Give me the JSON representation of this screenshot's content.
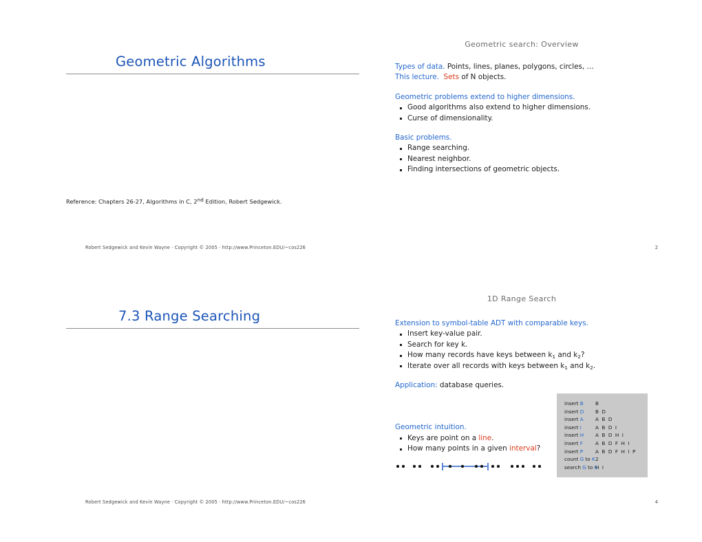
{
  "document": {
    "type": "lecture-slides-handout",
    "colors": {
      "heading_blue": "#2266cc",
      "title_blue": "#1b54b8",
      "accent_red": "#d93a1a",
      "table_background": "#c9c9c9",
      "rule_gray": "#8b8b8b",
      "slide_header_gray": "#6a6a6a"
    }
  },
  "slide1": {
    "header": "Geometric search:  Overview",
    "title": "Geometric Algorithms",
    "blocks": [
      {
        "lines": [
          {
            "label": "Types of data.",
            "label_color": "blue",
            "text": " Points, lines, planes, polygons, circles, …"
          },
          {
            "label": "This lecture.",
            "label_color": "blue",
            "text": " of N objects.",
            "accent": "Sets"
          }
        ]
      },
      {
        "heading": "Geometric problems extend to higher dimensions.",
        "bullets": [
          "Good algorithms also extend to higher dimensions.",
          "Curse of dimensionality."
        ]
      },
      {
        "heading": "Basic problems.",
        "bullets": [
          "Range searching.",
          "Nearest neighbor.",
          "Finding intersections of geometric objects."
        ]
      }
    ],
    "reference": {
      "label": "Reference:",
      "text_before": "  Chapters 26-27, Algorithms in C, 2",
      "superscript": "nd",
      "text_after": " Edition, Robert Sedgewick."
    },
    "footer": "Robert Sedgewick and Kevin Wayne   ·   Copyright © 2005   ·   http://www.Princeton.EDU/~cos226",
    "page_number": "2"
  },
  "slide2": {
    "header": "1D Range Search",
    "title": "7.3  Range Searching",
    "blocks": [
      {
        "heading": "Extension to symbol-table ADT with comparable keys.",
        "bullets_rich": [
          {
            "parts": [
              {
                "t": "Insert key-value pair."
              }
            ]
          },
          {
            "parts": [
              {
                "t": "Search for key k."
              }
            ]
          },
          {
            "parts": [
              {
                "t": "How many records have keys between k"
              },
              {
                "sub": "1"
              },
              {
                "t": " and k"
              },
              {
                "sub": "2"
              },
              {
                "t": "?"
              }
            ]
          },
          {
            "parts": [
              {
                "t": "Iterate over all records with keys between k"
              },
              {
                "sub": "1"
              },
              {
                "t": " and k"
              },
              {
                "sub": "2"
              },
              {
                "t": "."
              }
            ]
          }
        ]
      },
      {
        "application_label": "Application:",
        "application_text": "  database queries."
      },
      {
        "heading": "Geometric intuition.",
        "bullets_rich": [
          {
            "parts": [
              {
                "t": "Keys are point on a "
              },
              {
                "t": "line",
                "c": "red"
              },
              {
                "t": "."
              }
            ]
          },
          {
            "parts": [
              {
                "t": "How many points in a given "
              },
              {
                "t": "interval",
                "c": "red"
              },
              {
                "t": "?"
              }
            ]
          }
        ]
      }
    ],
    "trace_table": {
      "rows": [
        {
          "op_prefix": "insert ",
          "op_key": "B",
          "result": "B"
        },
        {
          "op_prefix": "insert ",
          "op_key": "D",
          "result": "B D"
        },
        {
          "op_prefix": "insert ",
          "op_key": "A",
          "result": "A B D"
        },
        {
          "op_prefix": "insert ",
          "op_key": "I",
          "result": "A B D I"
        },
        {
          "op_prefix": "insert ",
          "op_key": "H",
          "result": "A B D H I"
        },
        {
          "op_prefix": "insert ",
          "op_key": "F",
          "result": "A B D F H I"
        },
        {
          "op_prefix": "insert ",
          "op_key": "P",
          "result": "A B D F H I P"
        },
        {
          "op_prefix": "count ",
          "op_key": "G",
          "op_mid": " to ",
          "op_key2": "K",
          "result": "2"
        },
        {
          "op_prefix": "search ",
          "op_key": "G",
          "op_mid": " to ",
          "op_key2": "K",
          "result": "H I"
        }
      ]
    },
    "number_line": {
      "description": "points on a line with a highlighted query interval",
      "dots_outside_left": [
        6,
        14,
        30,
        38,
        56,
        64
      ],
      "interval_start": 72,
      "interval_end": 138,
      "dots_inside": [
        82,
        100,
        120,
        128
      ],
      "dots_outside_right": [
        144,
        152,
        172,
        180,
        188,
        204,
        212
      ],
      "interval_color": "#5b86d6",
      "dot_color": "#111111"
    },
    "footer": "Robert Sedgewick and Kevin Wayne   ·   Copyright © 2005   ·   http://www.Princeton.EDU/~cos226",
    "page_number": "4"
  }
}
